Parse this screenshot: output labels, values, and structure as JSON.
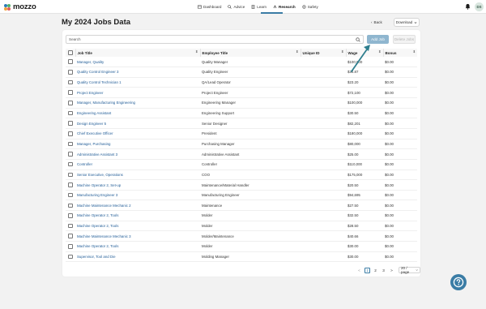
{
  "app": {
    "logo_text": "mozzo"
  },
  "nav": [
    {
      "label": "Dashboard",
      "icon": "dashboard-icon"
    },
    {
      "label": "Advice",
      "icon": "advice-icon"
    },
    {
      "label": "Learn",
      "icon": "learn-icon"
    },
    {
      "label": "Research",
      "icon": "research-icon",
      "active": true
    },
    {
      "label": "Safety",
      "icon": "safety-icon"
    }
  ],
  "user": {
    "initials": "DS"
  },
  "page": {
    "title": "My 2024 Jobs Data",
    "back_label": "Back",
    "download_label": "Download"
  },
  "toolbar": {
    "search_placeholder": "Search",
    "add_label": "Add Job",
    "delete_label": "Delete Jobs"
  },
  "table": {
    "headers": [
      "Job Title",
      "Employee Title",
      "Unique ID",
      "Wage",
      "Bonus"
    ],
    "rows": [
      {
        "job": "Manager, Quality",
        "employee": "Quality Manager",
        "id": "",
        "wage": "$100,000",
        "bonus": "$0.00"
      },
      {
        "job": "Quality Control Engineer 3",
        "employee": "Quality Engineer",
        "id": "",
        "wage": "$34.87",
        "bonus": "$0.00"
      },
      {
        "job": "Quality Control Technician 1",
        "employee": "QA/Lead Operator",
        "id": "",
        "wage": "$23.20",
        "bonus": "$0.00"
      },
      {
        "job": "Project Engineer",
        "employee": "Project Engineer",
        "id": "",
        "wage": "$72,100",
        "bonus": "$0.00"
      },
      {
        "job": "Manager, Manufacturing Engineering",
        "employee": "Engineering Manager",
        "id": "",
        "wage": "$100,000",
        "bonus": "$0.00"
      },
      {
        "job": "Engineering Assistant",
        "employee": "Engineering Support",
        "id": "",
        "wage": "$30.50",
        "bonus": "$0.00"
      },
      {
        "job": "Design Engineer 5",
        "employee": "Senior Designer",
        "id": "",
        "wage": "$82,201",
        "bonus": "$0.00"
      },
      {
        "job": "Chief Executive Officer",
        "employee": "President",
        "id": "",
        "wage": "$180,000",
        "bonus": "$0.00"
      },
      {
        "job": "Manager, Purchasing",
        "employee": "Purchasing Manager",
        "id": "",
        "wage": "$80,000",
        "bonus": "$0.00"
      },
      {
        "job": "Administrative Assistant 3",
        "employee": "Administrative Assistant",
        "id": "",
        "wage": "$25.00",
        "bonus": "$0.00"
      },
      {
        "job": "Controller",
        "employee": "Controller",
        "id": "",
        "wage": "$110,000",
        "bonus": "$0.00"
      },
      {
        "job": "Senior Executive, Operations",
        "employee": "COO",
        "id": "",
        "wage": "$175,000",
        "bonus": "$0.00"
      },
      {
        "job": "Machine Operator 2, Set-up",
        "employee": "Maintenance/Material Handler",
        "id": "",
        "wage": "$20.50",
        "bonus": "$0.00"
      },
      {
        "job": "Manufacturing Engineer 3",
        "employee": "Manufacturing Engineer",
        "id": "",
        "wage": "$94,695",
        "bonus": "$0.00"
      },
      {
        "job": "Machine Maintenance Mechanic 2",
        "employee": "Maintenance",
        "id": "",
        "wage": "$27.50",
        "bonus": "$0.00"
      },
      {
        "job": "Machine Operator 2, Tools",
        "employee": "Molder",
        "id": "",
        "wage": "$32.50",
        "bonus": "$0.00"
      },
      {
        "job": "Machine Operator 2, Tools",
        "employee": "Molder",
        "id": "",
        "wage": "$28.50",
        "bonus": "$0.00"
      },
      {
        "job": "Machine Maintenance Mechanic 3",
        "employee": "Molder/Maintenance",
        "id": "",
        "wage": "$40.66",
        "bonus": "$0.00"
      },
      {
        "job": "Machine Operator 2, Tools",
        "employee": "Molder",
        "id": "",
        "wage": "$30.00",
        "bonus": "$0.00"
      },
      {
        "job": "Supervisor, Tool and Die",
        "employee": "Molding Manager",
        "id": "",
        "wage": "$30.00",
        "bonus": "$0.00"
      }
    ]
  },
  "pagination": {
    "prev": "<",
    "pages": [
      "1",
      "2",
      "3"
    ],
    "active_page": "1",
    "next": ">",
    "page_size": "20 / page"
  },
  "colors": {
    "accent": "#3a7ca5",
    "link": "#1f5b96",
    "add_button": "#8fb6cf",
    "annotation_arrow": "#2f7f8f"
  }
}
